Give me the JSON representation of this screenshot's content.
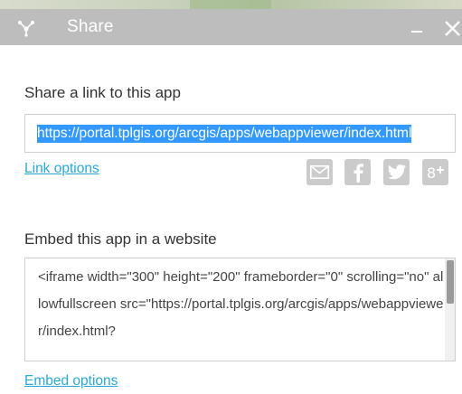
{
  "window": {
    "title": "Share",
    "icon": "share-icon",
    "minimize_icon": "minimize-icon",
    "close_icon": "close-icon"
  },
  "share_link": {
    "label": "Share a link to this app",
    "url": "https://portal.tplgis.org/arcgis/apps/webappviewer/index.html",
    "options_label": "Link options"
  },
  "social": [
    {
      "name": "email-icon"
    },
    {
      "name": "facebook-icon"
    },
    {
      "name": "twitter-icon"
    },
    {
      "name": "googleplus-icon"
    }
  ],
  "embed": {
    "label": "Embed this app in a website",
    "code": "<iframe width=\"300\" height=\"200\" frameborder=\"0\" scrolling=\"no\" allowfullscreen src=\"https://portal.tplgis.org/arcgis/apps/webappviewer/index.html?",
    "options_label": "Embed options"
  },
  "colors": {
    "titlebar": "#bdbdbd",
    "link": "#2aa8d8",
    "selection": "#3399ff",
    "social_icon": "#cbcbcb"
  }
}
